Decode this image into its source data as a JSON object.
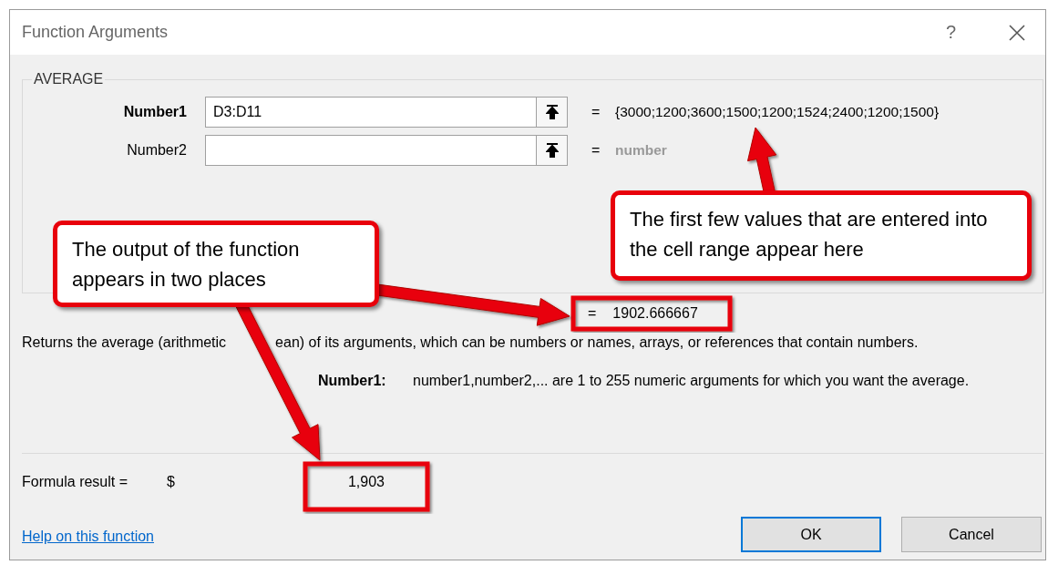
{
  "window": {
    "title": "Function Arguments",
    "help": "?"
  },
  "function": {
    "name": "AVERAGE",
    "arguments": [
      {
        "label": "Number1",
        "selected": true,
        "value": "D3:D11",
        "equals": "=",
        "result": "{3000;1200;3600;1500;1200;1524;2400;1200;1500}",
        "kind": "value"
      },
      {
        "label": "Number2",
        "selected": false,
        "equals": "=",
        "result": "number",
        "kind": "hint"
      }
    ],
    "result_equals": "=",
    "result": "1902.666667"
  },
  "description": [
    "Returns the average (arithmetic",
    "ean) of its arguments, which can be numbers or names, arrays, or references that contain numbers."
  ],
  "argument_help": {
    "label": "Number1:",
    "text": "number1,number2,... are 1 to 255 numeric arguments for which you want the average."
  },
  "formula_result": {
    "label": "Formula result =",
    "currency": "$",
    "value": "1,903"
  },
  "help_link": "Help on this function",
  "buttons": [
    {
      "label": "OK",
      "default": true
    },
    {
      "label": "Cancel",
      "default": false
    }
  ],
  "callouts": [
    {
      "text": "The first few values that are entered into the cell range appear here"
    },
    {
      "text": "The output of the function appears in two places"
    }
  ]
}
